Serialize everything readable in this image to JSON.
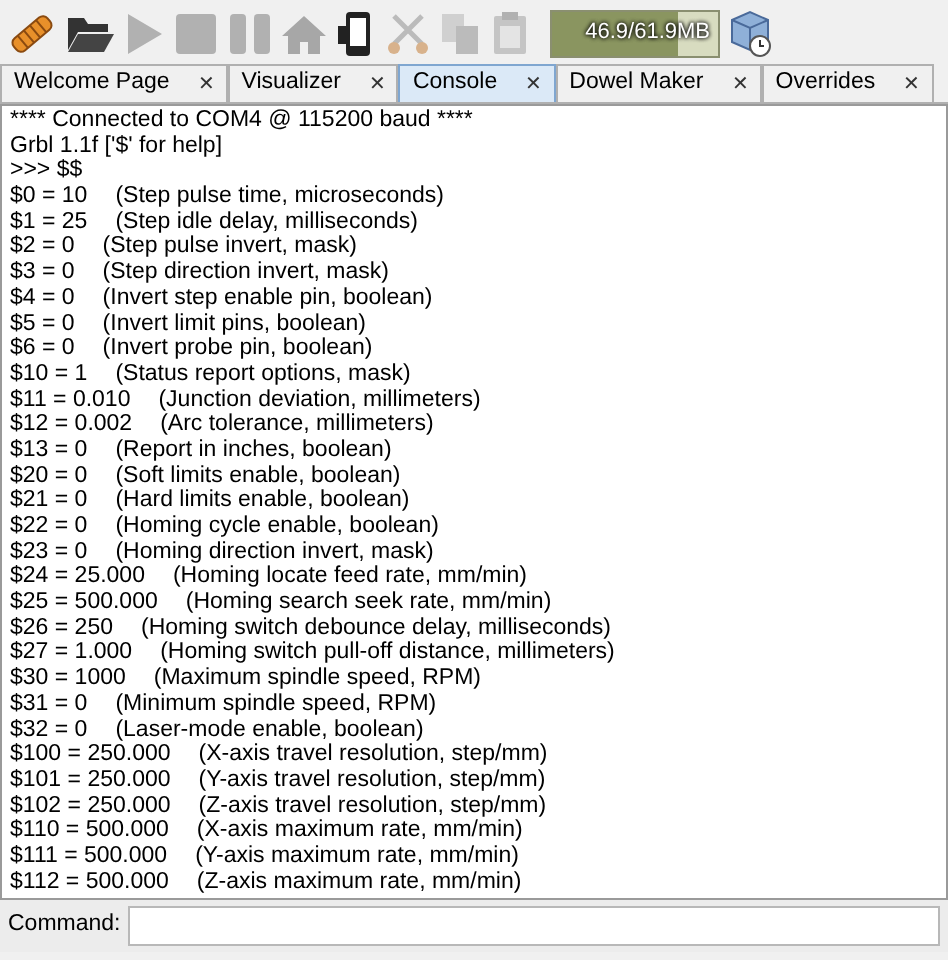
{
  "toolbar": {
    "tools": [
      {
        "kind": "dowel",
        "disabled": false
      },
      {
        "kind": "open",
        "disabled": false
      },
      {
        "kind": "play",
        "disabled": true
      },
      {
        "kind": "stop",
        "disabled": true
      },
      {
        "kind": "pause",
        "disabled": true
      },
      {
        "kind": "home",
        "disabled": true
      },
      {
        "kind": "device",
        "disabled": false
      },
      {
        "kind": "cut",
        "disabled": true
      },
      {
        "kind": "copy",
        "disabled": true
      },
      {
        "kind": "paste",
        "disabled": true
      }
    ],
    "memory": {
      "reading": "46.9/61.9MB",
      "level": 0.76
    }
  },
  "tabs": [
    {
      "label": "Welcome Page",
      "close": "✕",
      "selected": false
    },
    {
      "label": "Visualizer",
      "close": "✕",
      "selected": false
    },
    {
      "label": "Console",
      "close": "✕",
      "selected": true
    },
    {
      "label": "Dowel Maker",
      "close": "✕",
      "selected": false
    },
    {
      "label": "Overrides",
      "close": "✕",
      "selected": false
    }
  ],
  "console": {
    "lines": [
      {
        "text": "**** Connected to COM4 @ 115200 baud ****"
      },
      {
        "text": "Grbl 1.1f ['$' for help]"
      },
      {
        "text": ">>> $$"
      },
      {
        "setting": "$0 = 10",
        "description": "(Step pulse time, microseconds)"
      },
      {
        "setting": "$1 = 25",
        "description": "(Step idle delay, milliseconds)"
      },
      {
        "setting": "$2 = 0",
        "description": "(Step pulse invert, mask)"
      },
      {
        "setting": "$3 = 0",
        "description": "(Step direction invert, mask)"
      },
      {
        "setting": "$4 = 0",
        "description": "(Invert step enable pin, boolean)"
      },
      {
        "setting": "$5 = 0",
        "description": "(Invert limit pins, boolean)"
      },
      {
        "setting": "$6 = 0",
        "description": "(Invert probe pin, boolean)"
      },
      {
        "setting": "$10 = 1",
        "description": "(Status report options, mask)"
      },
      {
        "setting": "$11 = 0.010",
        "description": "(Junction deviation, millimeters)"
      },
      {
        "setting": "$12 = 0.002",
        "description": "(Arc tolerance, millimeters)"
      },
      {
        "setting": "$13 = 0",
        "description": "(Report in inches, boolean)"
      },
      {
        "setting": "$20 = 0",
        "description": "(Soft limits enable, boolean)"
      },
      {
        "setting": "$21 = 0",
        "description": "(Hard limits enable, boolean)"
      },
      {
        "setting": "$22 = 0",
        "description": "(Homing cycle enable, boolean)"
      },
      {
        "setting": "$23 = 0",
        "description": "(Homing direction invert, mask)"
      },
      {
        "setting": "$24 = 25.000",
        "description": "(Homing locate feed rate, mm/min)"
      },
      {
        "setting": "$25 = 500.000",
        "description": "(Homing search seek rate, mm/min)"
      },
      {
        "setting": "$26 = 250",
        "description": "(Homing switch debounce delay, milliseconds)"
      },
      {
        "setting": "$27 = 1.000",
        "description": "(Homing switch pull-off distance, millimeters)"
      },
      {
        "setting": "$30 = 1000",
        "description": "(Maximum spindle speed, RPM)"
      },
      {
        "setting": "$31 = 0",
        "description": "(Minimum spindle speed, RPM)"
      },
      {
        "setting": "$32 = 0",
        "description": "(Laser-mode enable, boolean)"
      },
      {
        "setting": "$100 = 250.000",
        "description": "(X-axis travel resolution, step/mm)"
      },
      {
        "setting": "$101 = 250.000",
        "description": "(Y-axis travel resolution, step/mm)"
      },
      {
        "setting": "$102 = 250.000",
        "description": "(Z-axis travel resolution, step/mm)"
      },
      {
        "setting": "$110 = 500.000",
        "description": "(X-axis maximum rate, mm/min)"
      },
      {
        "setting": "$111 = 500.000",
        "description": "(Y-axis maximum rate, mm/min)"
      },
      {
        "setting": "$112 = 500.000",
        "description": "(Z-axis maximum rate, mm/min)"
      }
    ]
  },
  "command": {
    "label": "Command:"
  }
}
